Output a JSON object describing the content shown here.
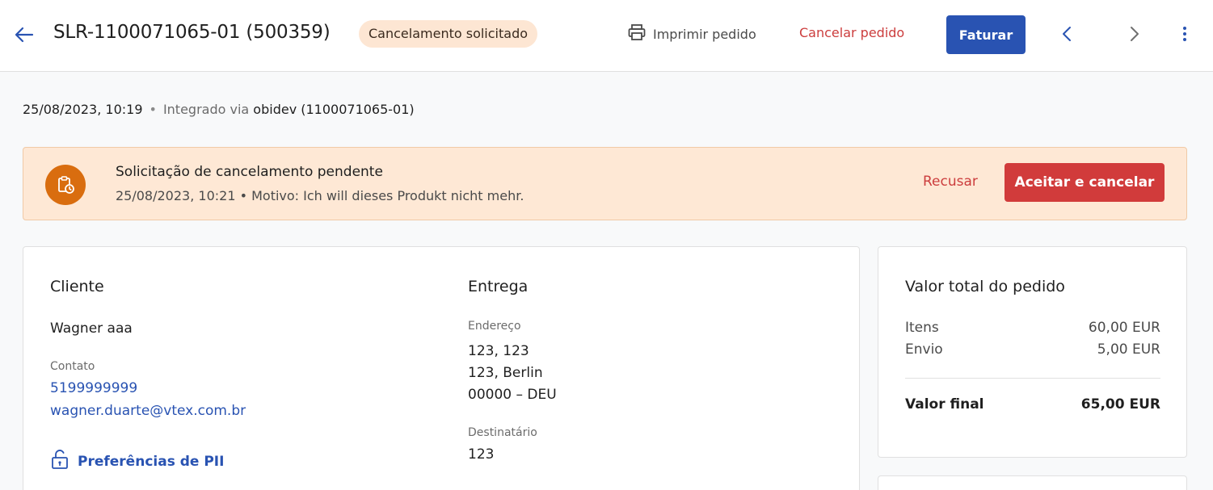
{
  "header": {
    "order_title": "SLR-1100071065-01 (500359)",
    "status_badge": "Cancelamento solicitado",
    "print_label": "Imprimir pedido",
    "cancel_label": "Cancelar pedido",
    "invoice_label": "Faturar"
  },
  "meta": {
    "datetime": "25/08/2023, 10:19",
    "separator": "•",
    "integrated_prefix": "Integrado via",
    "integrated_source": "obidev (1100071065-01)"
  },
  "alert": {
    "title": "Solicitação de cancelamento pendente",
    "subtitle": "25/08/2023, 10:21 • Motivo: Ich will dieses Produkt nicht mehr.",
    "refuse_label": "Recusar",
    "accept_label": "Aceitar e cancelar"
  },
  "customer": {
    "heading": "Cliente",
    "name": "Wagner aaa",
    "contact_label": "Contato",
    "phone": "5199999999",
    "email": "wagner.duarte@vtex.com.br",
    "pii_label": "Preferências de PII"
  },
  "delivery": {
    "heading": "Entrega",
    "address_label": "Endereço",
    "address_line1": "123, 123",
    "address_line2": "123, Berlin",
    "address_line3": "00000 – DEU",
    "recipient_label": "Destinatário",
    "recipient": "123"
  },
  "totals": {
    "heading": "Valor total do pedido",
    "items_label": "Itens",
    "items_value": "60,00 EUR",
    "shipping_label": "Envio",
    "shipping_value": "5,00 EUR",
    "final_label": "Valor final",
    "final_value": "65,00 EUR"
  },
  "colors": {
    "primary": "#2953b2",
    "danger": "#d13b3b",
    "alert_bg": "#fee8d5",
    "alert_icon": "#d96d0f",
    "badge_bg": "#fde6d3"
  },
  "icons": [
    "arrow-left-icon",
    "printer-icon",
    "chevron-left-icon",
    "chevron-right-icon",
    "kebab-menu-icon",
    "clipboard-clock-icon",
    "lock-icon"
  ]
}
